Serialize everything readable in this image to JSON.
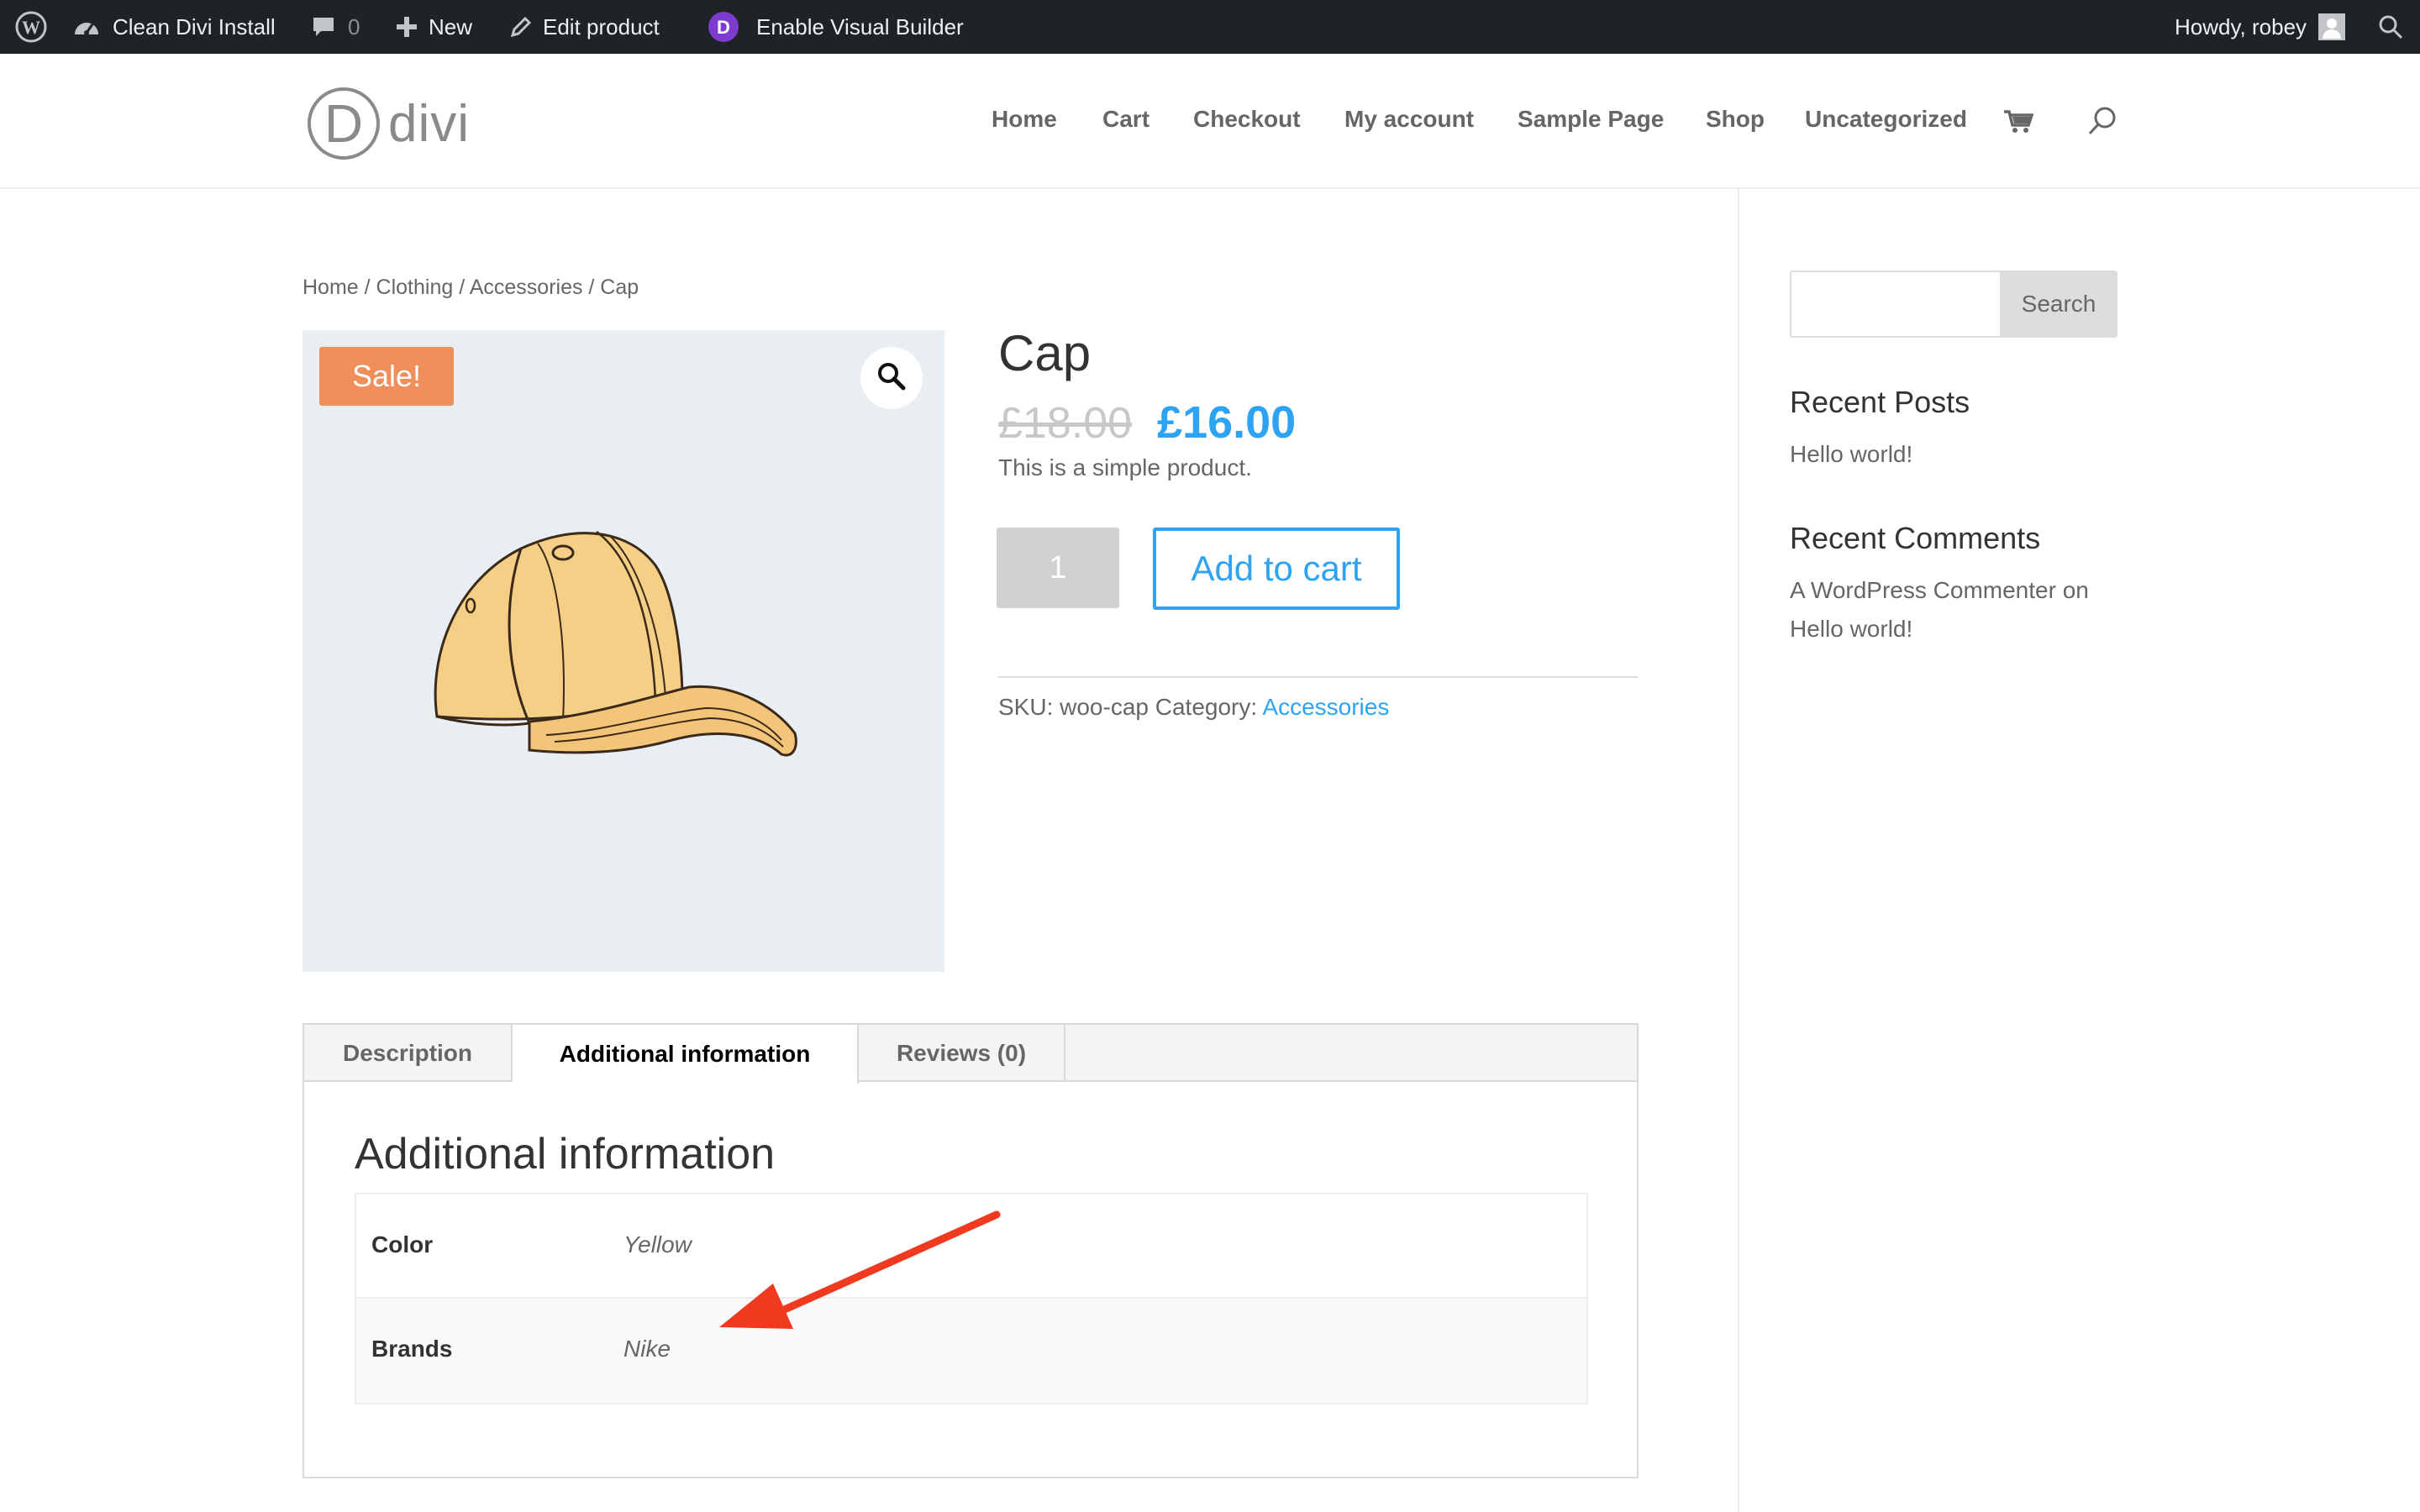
{
  "admin_bar": {
    "site_name": "Clean Divi Install",
    "comments_count": "0",
    "new_label": "New",
    "edit_label": "Edit product",
    "visual_builder_label": "Enable Visual Builder",
    "greeting": "Howdy, robey"
  },
  "header": {
    "logo_letter": "D",
    "logo_word": "divi",
    "nav": [
      "Home",
      "Cart",
      "Checkout",
      "My account",
      "Sample Page",
      "Shop",
      "Uncategorized"
    ]
  },
  "breadcrumb": "Home / Clothing / Accessories / Cap",
  "product": {
    "sale_badge": "Sale!",
    "title": "Cap",
    "price_old": "£18.00",
    "price_new": "£16.00",
    "short_description": "This is a simple product.",
    "quantity": "1",
    "add_to_cart_label": "Add to cart",
    "sku_label": "SKU:",
    "sku": "woo-cap",
    "category_label": "Category:",
    "category": "Accessories"
  },
  "tabs": {
    "items": [
      "Description",
      "Additional information",
      "Reviews (0)"
    ],
    "active": "Additional information",
    "panel_heading": "Additional information",
    "attributes": [
      {
        "label": "Color",
        "value": "Yellow"
      },
      {
        "label": "Brands",
        "value": "Nike"
      }
    ]
  },
  "sidebar": {
    "search_button": "Search",
    "recent_posts_title": "Recent Posts",
    "recent_posts": [
      "Hello world!"
    ],
    "recent_comments_title": "Recent Comments",
    "comment_author": "A WordPress Commenter",
    "comment_on": "on",
    "comment_post": "Hello world!"
  },
  "colors": {
    "accent": "#2ea3f2",
    "sale_badge": "#ef8f5b",
    "admin_bar": "#1d2327",
    "annotation_arrow": "#f03a1f"
  }
}
